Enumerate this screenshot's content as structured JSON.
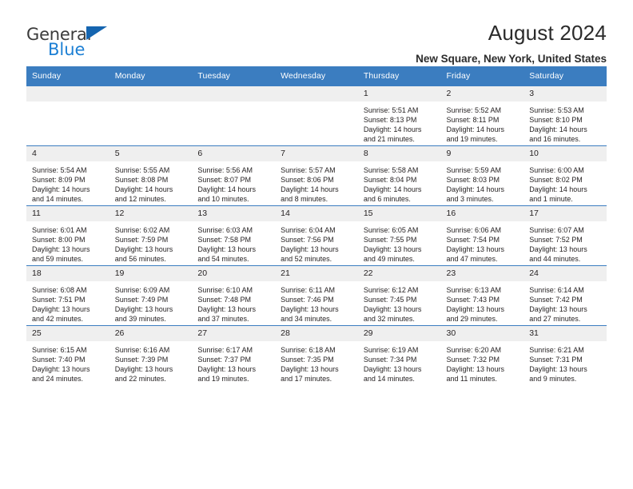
{
  "brand": {
    "name_part1": "General",
    "name_part2": "Blue",
    "accent_color": "#1c7fd4",
    "triangle_color": "#1565b0"
  },
  "header": {
    "title": "August 2024",
    "subtitle": "New Square, New York, United States",
    "header_bg_color": "#3b7dc0"
  },
  "weekday_headers": [
    "Sunday",
    "Monday",
    "Tuesday",
    "Wednesday",
    "Thursday",
    "Friday",
    "Saturday"
  ],
  "labels": {
    "sunrise_prefix": "Sunrise:",
    "sunset_prefix": "Sunset:",
    "daylight_prefix": "Daylight:"
  },
  "weeks": [
    [
      {
        "day": "",
        "line1": "",
        "line2": "",
        "line3": "",
        "line4": "",
        "empty": true
      },
      {
        "day": "",
        "line1": "",
        "line2": "",
        "line3": "",
        "line4": "",
        "empty": true
      },
      {
        "day": "",
        "line1": "",
        "line2": "",
        "line3": "",
        "line4": "",
        "empty": true
      },
      {
        "day": "",
        "line1": "",
        "line2": "",
        "line3": "",
        "line4": "",
        "empty": true
      },
      {
        "day": "1",
        "line1": "Sunrise: 5:51 AM",
        "line2": "Sunset: 8:13 PM",
        "line3": "Daylight: 14 hours",
        "line4": "and 21 minutes.",
        "empty": false
      },
      {
        "day": "2",
        "line1": "Sunrise: 5:52 AM",
        "line2": "Sunset: 8:11 PM",
        "line3": "Daylight: 14 hours",
        "line4": "and 19 minutes.",
        "empty": false
      },
      {
        "day": "3",
        "line1": "Sunrise: 5:53 AM",
        "line2": "Sunset: 8:10 PM",
        "line3": "Daylight: 14 hours",
        "line4": "and 16 minutes.",
        "empty": false
      }
    ],
    [
      {
        "day": "4",
        "line1": "Sunrise: 5:54 AM",
        "line2": "Sunset: 8:09 PM",
        "line3": "Daylight: 14 hours",
        "line4": "and 14 minutes.",
        "empty": false
      },
      {
        "day": "5",
        "line1": "Sunrise: 5:55 AM",
        "line2": "Sunset: 8:08 PM",
        "line3": "Daylight: 14 hours",
        "line4": "and 12 minutes.",
        "empty": false
      },
      {
        "day": "6",
        "line1": "Sunrise: 5:56 AM",
        "line2": "Sunset: 8:07 PM",
        "line3": "Daylight: 14 hours",
        "line4": "and 10 minutes.",
        "empty": false
      },
      {
        "day": "7",
        "line1": "Sunrise: 5:57 AM",
        "line2": "Sunset: 8:06 PM",
        "line3": "Daylight: 14 hours",
        "line4": "and 8 minutes.",
        "empty": false
      },
      {
        "day": "8",
        "line1": "Sunrise: 5:58 AM",
        "line2": "Sunset: 8:04 PM",
        "line3": "Daylight: 14 hours",
        "line4": "and 6 minutes.",
        "empty": false
      },
      {
        "day": "9",
        "line1": "Sunrise: 5:59 AM",
        "line2": "Sunset: 8:03 PM",
        "line3": "Daylight: 14 hours",
        "line4": "and 3 minutes.",
        "empty": false
      },
      {
        "day": "10",
        "line1": "Sunrise: 6:00 AM",
        "line2": "Sunset: 8:02 PM",
        "line3": "Daylight: 14 hours",
        "line4": "and 1 minute.",
        "empty": false
      }
    ],
    [
      {
        "day": "11",
        "line1": "Sunrise: 6:01 AM",
        "line2": "Sunset: 8:00 PM",
        "line3": "Daylight: 13 hours",
        "line4": "and 59 minutes.",
        "empty": false
      },
      {
        "day": "12",
        "line1": "Sunrise: 6:02 AM",
        "line2": "Sunset: 7:59 PM",
        "line3": "Daylight: 13 hours",
        "line4": "and 56 minutes.",
        "empty": false
      },
      {
        "day": "13",
        "line1": "Sunrise: 6:03 AM",
        "line2": "Sunset: 7:58 PM",
        "line3": "Daylight: 13 hours",
        "line4": "and 54 minutes.",
        "empty": false
      },
      {
        "day": "14",
        "line1": "Sunrise: 6:04 AM",
        "line2": "Sunset: 7:56 PM",
        "line3": "Daylight: 13 hours",
        "line4": "and 52 minutes.",
        "empty": false
      },
      {
        "day": "15",
        "line1": "Sunrise: 6:05 AM",
        "line2": "Sunset: 7:55 PM",
        "line3": "Daylight: 13 hours",
        "line4": "and 49 minutes.",
        "empty": false
      },
      {
        "day": "16",
        "line1": "Sunrise: 6:06 AM",
        "line2": "Sunset: 7:54 PM",
        "line3": "Daylight: 13 hours",
        "line4": "and 47 minutes.",
        "empty": false
      },
      {
        "day": "17",
        "line1": "Sunrise: 6:07 AM",
        "line2": "Sunset: 7:52 PM",
        "line3": "Daylight: 13 hours",
        "line4": "and 44 minutes.",
        "empty": false
      }
    ],
    [
      {
        "day": "18",
        "line1": "Sunrise: 6:08 AM",
        "line2": "Sunset: 7:51 PM",
        "line3": "Daylight: 13 hours",
        "line4": "and 42 minutes.",
        "empty": false
      },
      {
        "day": "19",
        "line1": "Sunrise: 6:09 AM",
        "line2": "Sunset: 7:49 PM",
        "line3": "Daylight: 13 hours",
        "line4": "and 39 minutes.",
        "empty": false
      },
      {
        "day": "20",
        "line1": "Sunrise: 6:10 AM",
        "line2": "Sunset: 7:48 PM",
        "line3": "Daylight: 13 hours",
        "line4": "and 37 minutes.",
        "empty": false
      },
      {
        "day": "21",
        "line1": "Sunrise: 6:11 AM",
        "line2": "Sunset: 7:46 PM",
        "line3": "Daylight: 13 hours",
        "line4": "and 34 minutes.",
        "empty": false
      },
      {
        "day": "22",
        "line1": "Sunrise: 6:12 AM",
        "line2": "Sunset: 7:45 PM",
        "line3": "Daylight: 13 hours",
        "line4": "and 32 minutes.",
        "empty": false
      },
      {
        "day": "23",
        "line1": "Sunrise: 6:13 AM",
        "line2": "Sunset: 7:43 PM",
        "line3": "Daylight: 13 hours",
        "line4": "and 29 minutes.",
        "empty": false
      },
      {
        "day": "24",
        "line1": "Sunrise: 6:14 AM",
        "line2": "Sunset: 7:42 PM",
        "line3": "Daylight: 13 hours",
        "line4": "and 27 minutes.",
        "empty": false
      }
    ],
    [
      {
        "day": "25",
        "line1": "Sunrise: 6:15 AM",
        "line2": "Sunset: 7:40 PM",
        "line3": "Daylight: 13 hours",
        "line4": "and 24 minutes.",
        "empty": false
      },
      {
        "day": "26",
        "line1": "Sunrise: 6:16 AM",
        "line2": "Sunset: 7:39 PM",
        "line3": "Daylight: 13 hours",
        "line4": "and 22 minutes.",
        "empty": false
      },
      {
        "day": "27",
        "line1": "Sunrise: 6:17 AM",
        "line2": "Sunset: 7:37 PM",
        "line3": "Daylight: 13 hours",
        "line4": "and 19 minutes.",
        "empty": false
      },
      {
        "day": "28",
        "line1": "Sunrise: 6:18 AM",
        "line2": "Sunset: 7:35 PM",
        "line3": "Daylight: 13 hours",
        "line4": "and 17 minutes.",
        "empty": false
      },
      {
        "day": "29",
        "line1": "Sunrise: 6:19 AM",
        "line2": "Sunset: 7:34 PM",
        "line3": "Daylight: 13 hours",
        "line4": "and 14 minutes.",
        "empty": false
      },
      {
        "day": "30",
        "line1": "Sunrise: 6:20 AM",
        "line2": "Sunset: 7:32 PM",
        "line3": "Daylight: 13 hours",
        "line4": "and 11 minutes.",
        "empty": false
      },
      {
        "day": "31",
        "line1": "Sunrise: 6:21 AM",
        "line2": "Sunset: 7:31 PM",
        "line3": "Daylight: 13 hours",
        "line4": "and 9 minutes.",
        "empty": false
      }
    ]
  ]
}
